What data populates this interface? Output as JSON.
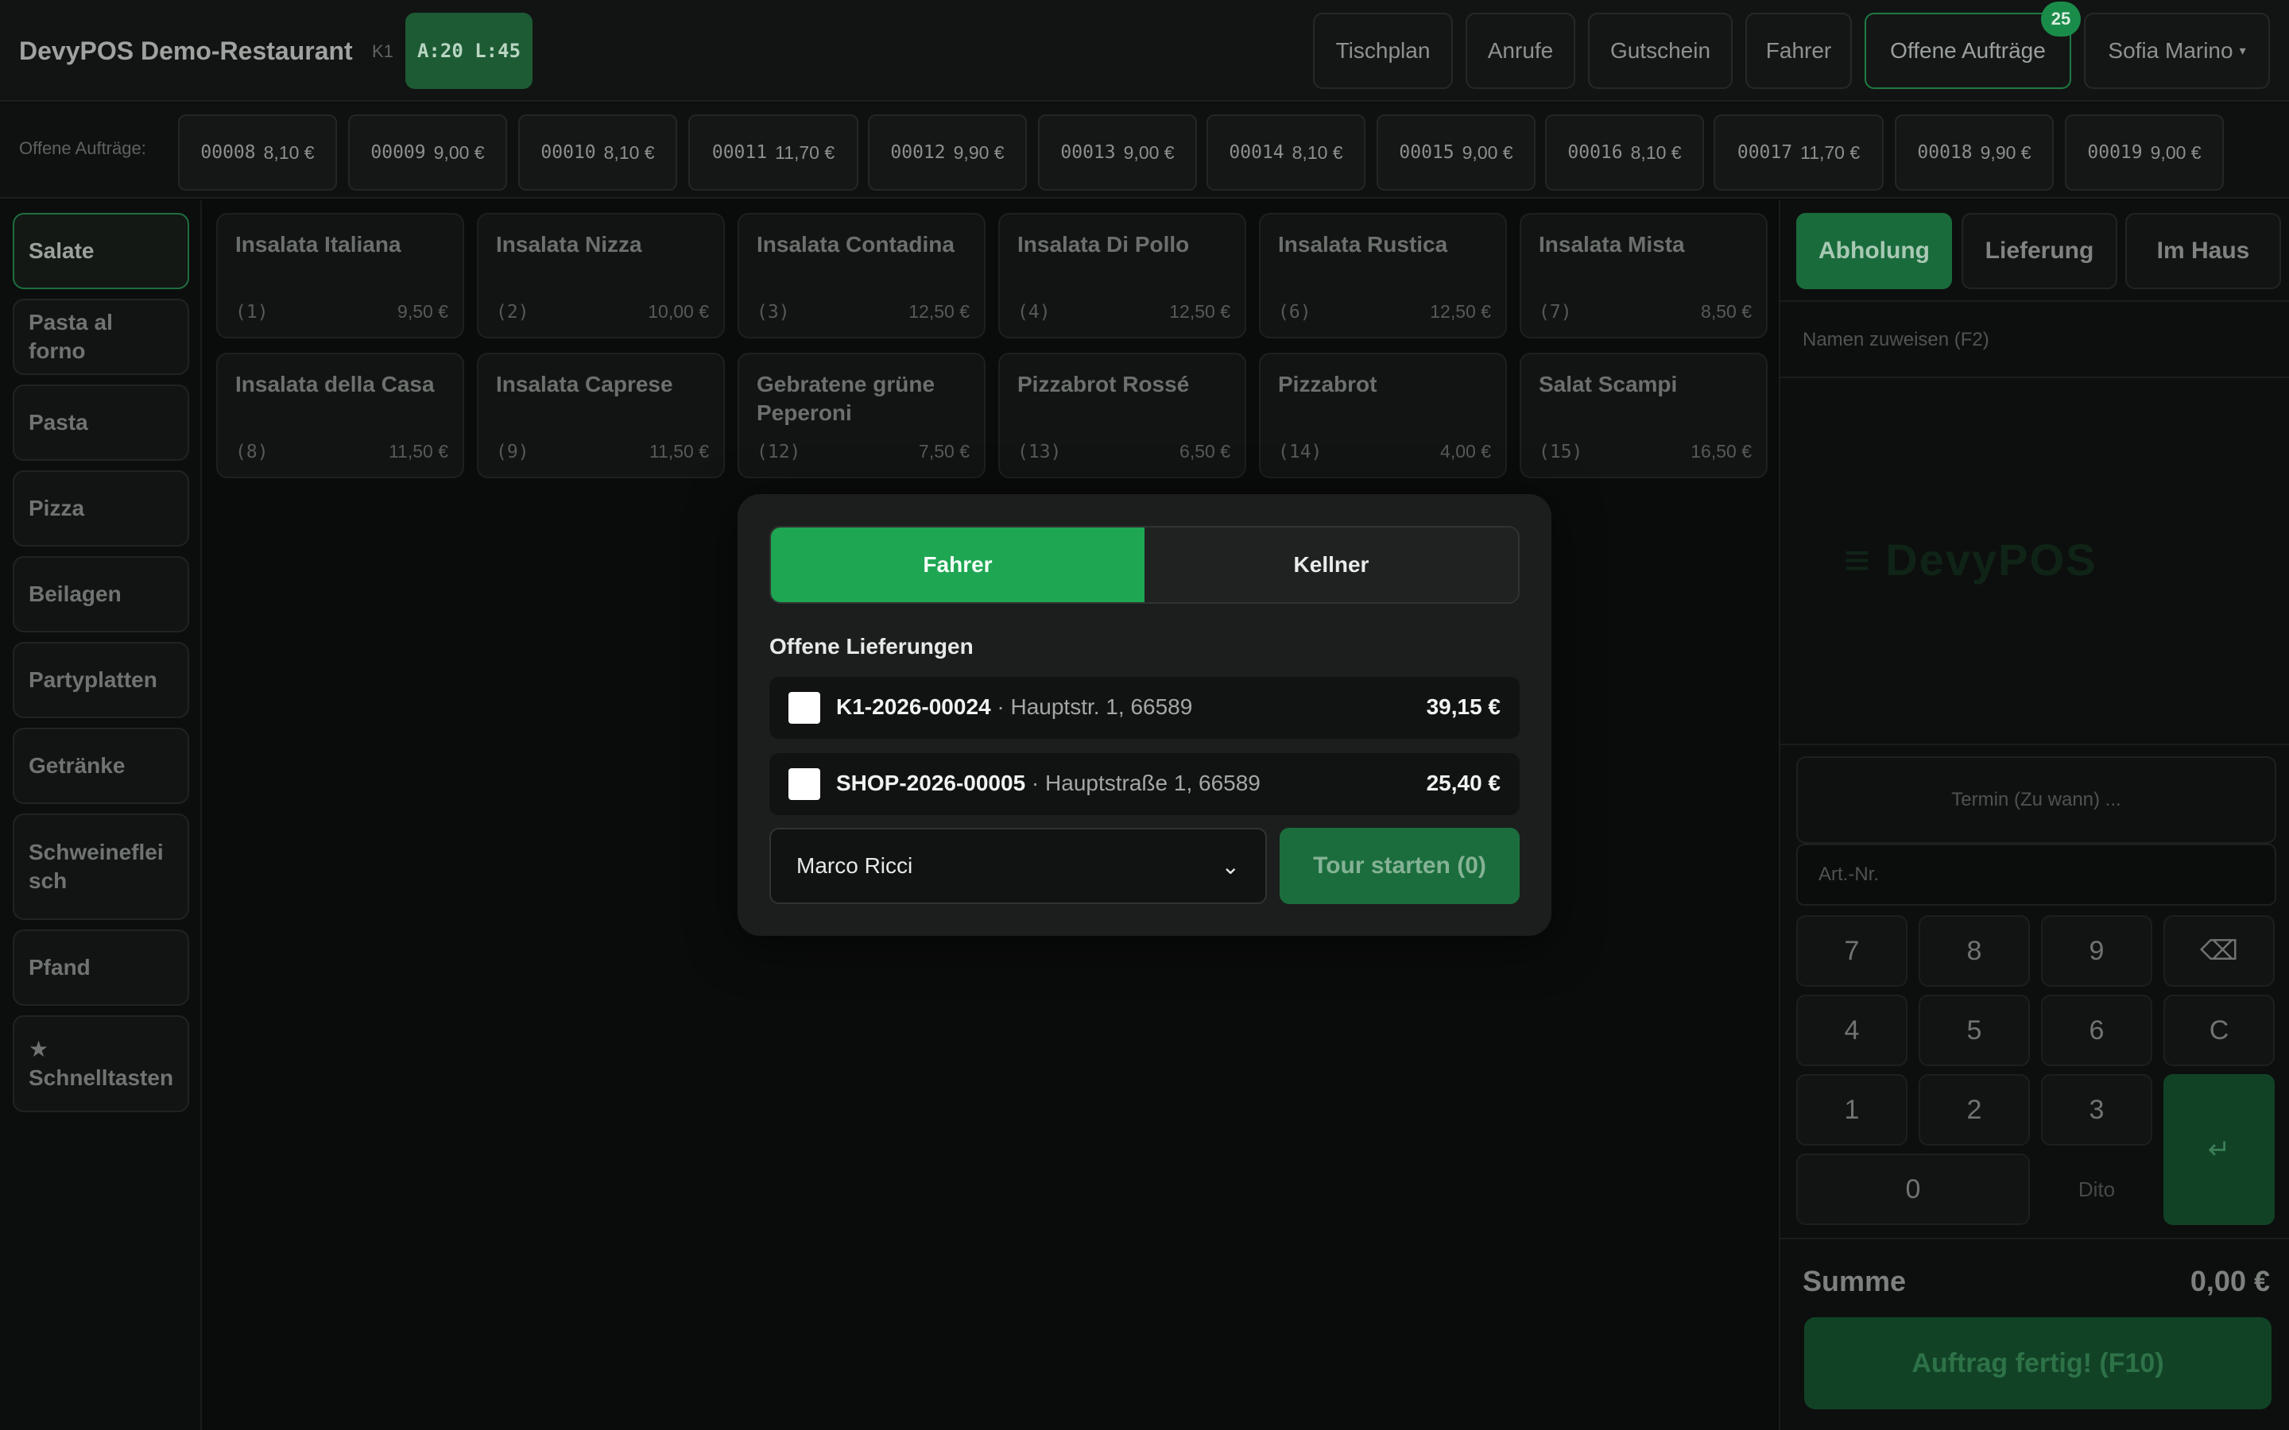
{
  "header": {
    "title": "DevyPOS Demo-Restaurant",
    "terminal": "K1",
    "counter": "A:20 L:45",
    "nav": [
      "Tischplan",
      "Anrufe",
      "Gutschein",
      "Fahrer",
      "Offene Aufträge"
    ],
    "open_orders_count": "25",
    "user": "Sofia Marino",
    "user_caret": "▾"
  },
  "open_orders": {
    "label": "Offene Aufträge:",
    "items": [
      {
        "id": "00008",
        "amount": "8,10 €"
      },
      {
        "id": "00009",
        "amount": "9,00 €"
      },
      {
        "id": "00010",
        "amount": "8,10 €"
      },
      {
        "id": "00011",
        "amount": "11,70 €"
      },
      {
        "id": "00012",
        "amount": "9,90 €"
      },
      {
        "id": "00013",
        "amount": "9,00 €"
      },
      {
        "id": "00014",
        "amount": "8,10 €"
      },
      {
        "id": "00015",
        "amount": "9,00 €"
      },
      {
        "id": "00016",
        "amount": "8,10 €"
      },
      {
        "id": "00017",
        "amount": "11,70 €"
      },
      {
        "id": "00018",
        "amount": "9,90 €"
      },
      {
        "id": "00019",
        "amount": "9,00 €"
      }
    ]
  },
  "categories": {
    "items": [
      "Salate",
      "Pasta al forno",
      "Pasta",
      "Pizza",
      "Beilagen",
      "Partyplatten",
      "Getränke",
      "Schweinefleisch",
      "Pfand"
    ],
    "favorites_icon": "★",
    "favorites_label": "Schnelltasten"
  },
  "products": [
    {
      "name": "Insalata Italiana",
      "num": "(1)",
      "price": "9,50 €"
    },
    {
      "name": "Insalata Nizza",
      "num": "(2)",
      "price": "10,00 €"
    },
    {
      "name": "Insalata Contadina",
      "num": "(3)",
      "price": "12,50 €"
    },
    {
      "name": "Insalata Di Pollo",
      "num": "(4)",
      "price": "12,50 €"
    },
    {
      "name": "Insalata Rustica",
      "num": "(6)",
      "price": "12,50 €"
    },
    {
      "name": "Insalata Mista",
      "num": "(7)",
      "price": "8,50 €"
    },
    {
      "name": "Insalata della Casa",
      "num": "(8)",
      "price": "11,50 €"
    },
    {
      "name": "Insalata Caprese",
      "num": "(9)",
      "price": "11,50 €"
    },
    {
      "name": "Gebratene grüne Peperoni",
      "num": "(12)",
      "price": "7,50 €"
    },
    {
      "name": "Pizzabrot Rossé",
      "num": "(13)",
      "price": "6,50 €"
    },
    {
      "name": "Pizzabrot",
      "num": "(14)",
      "price": "4,00 €"
    },
    {
      "name": "Salat Scampi",
      "num": "(15)",
      "price": "16,50 €"
    }
  ],
  "order_panel": {
    "modes": [
      "Abholung",
      "Lieferung",
      "Im Haus"
    ],
    "name_assign": "Namen zuweisen (F2)",
    "watermark": "≡ DevyPOS",
    "termin_placeholder": "Termin (Zu wann) ...",
    "artnr_placeholder": "Art.-Nr.",
    "keys": [
      "7",
      "8",
      "9",
      "⌫",
      "4",
      "5",
      "6",
      "C",
      "1",
      "2",
      "3",
      "↵",
      "0",
      "Dito"
    ],
    "sum_label": "Summe",
    "sum_value": "0,00 €",
    "finish_label": "Auftrag fertig! (F10)"
  },
  "modal": {
    "tabs": [
      "Fahrer",
      "Kellner"
    ],
    "heading": "Offene Lieferungen",
    "deliveries": [
      {
        "id": "K1-2026-00024",
        "address": " · Hauptstr. 1, 66589",
        "amount": "39,15 €"
      },
      {
        "id": "SHOP-2026-00005",
        "address": " · Hauptstraße 1, 66589",
        "amount": "25,40 €"
      }
    ],
    "driver": "Marco Ricci",
    "driver_caret": "⌄",
    "start_label": "Tour starten (0)"
  },
  "colors": {
    "accent": "#1ea653",
    "accent_dim": "#1a6b3b",
    "background": "#0a0c0b"
  }
}
